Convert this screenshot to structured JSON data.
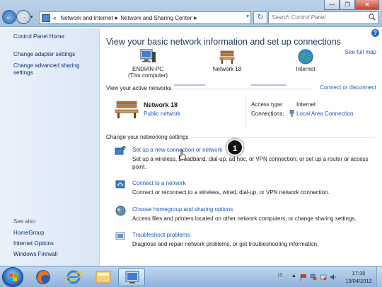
{
  "window": {
    "minimize_glyph": "—",
    "maximize_glyph": "❐",
    "close_glyph": "✕"
  },
  "nav": {
    "back_glyph": "←",
    "forward_glyph": "→",
    "recent_glyph": "▾",
    "refresh_glyph": "↻"
  },
  "address": {
    "prefix": "«",
    "crumbs": [
      "Network and Internet",
      "Network and Sharing Center"
    ],
    "sep": "▸",
    "dropdown_glyph": "▾"
  },
  "search": {
    "placeholder": "Search Control Panel"
  },
  "sidebar": {
    "home": "Control Panel Home",
    "items": [
      "Change adapter settings",
      "Change advanced sharing settings"
    ],
    "see_also_label": "See also",
    "see_also": [
      "HomeGroup",
      "Internet Options",
      "Windows Firewall"
    ]
  },
  "main": {
    "help_glyph": "?",
    "title": "View your basic network information and set up connections",
    "see_full_map": "See full map",
    "map": {
      "computer_line1": "ENDIAN-PC",
      "computer_line2": "(This computer)",
      "network": "Network  18",
      "internet": "Internet"
    },
    "active_header": "View your active networks",
    "connect_disconnect": "Connect or disconnect",
    "active_network": {
      "name": "Network  18",
      "type": "Public network",
      "access_label": "Access type:",
      "access_value": "Internet",
      "connections_label": "Connections:",
      "connections_value": "Local Area Connection"
    },
    "settings_header": "Change your networking settings",
    "tasks": [
      {
        "label": "Set up a new connection or network",
        "desc": "Set up a wireless, broadband, dial-up, ad hoc, or VPN connection; or set up a router or access point."
      },
      {
        "label": "Connect to a network",
        "desc": "Connect or reconnect to a wireless, wired, dial-up, or VPN network connection."
      },
      {
        "label": "Choose homegroup and sharing options",
        "desc": "Access files and printers located on other network computers, or change sharing settings."
      },
      {
        "label": "Troubleshoot problems",
        "desc": "Diagnose and repair network problems, or get troubleshooting information."
      }
    ],
    "step_badge": "1"
  },
  "taskbar": {
    "language": "IT",
    "tray_arrow": "▲",
    "time": "17:30",
    "date": "13/04/2012"
  },
  "colors": {
    "link": "#1a54b8",
    "sidebar_link": "#0d2d70",
    "title": "#1e395b"
  }
}
